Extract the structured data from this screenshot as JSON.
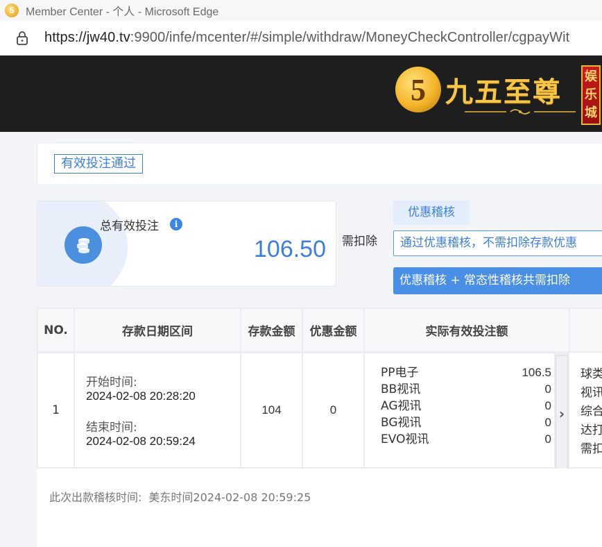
{
  "browser": {
    "window_title": "Member Center - 个人 - Microsoft Edge",
    "url_scheme": "https://",
    "url_host": "jw40.tv",
    "url_rest": ":9900/infe/mcenter/#/simple/withdraw/MoneyCheckController/cgpayWit"
  },
  "header": {
    "brand_mark": "5",
    "brand_name": "九五至尊",
    "brand_tag": [
      "娱",
      "乐",
      "城"
    ]
  },
  "status": {
    "pass_tag": "有效投注通过"
  },
  "summary": {
    "label": "总有效投注",
    "info": "i",
    "value": "106.50",
    "deduct_label": "需扣除",
    "promo_tab": "优惠稽核",
    "promo_message": "通过优惠稽核，不需扣除存款优惠",
    "promo_banner": "优惠稽核 + 常态性稽核共需扣除"
  },
  "table": {
    "headers": {
      "no": "NO.",
      "date_range": "存款日期区间",
      "deposit": "存款金额",
      "bonus": "优惠金额",
      "effective_bet": "实际有效投注额"
    },
    "row": {
      "no": "1",
      "start_label": "开始时间:",
      "start_value": "2024-02-08 20:28:20",
      "end_label": "结束时间:",
      "end_value": "2024-02-08 20:59:24",
      "deposit": "104",
      "bonus": "0",
      "bets": [
        {
          "name": "PP电子",
          "value": "106.5"
        },
        {
          "name": "BB视讯",
          "value": "0"
        },
        {
          "name": "AG视讯",
          "value": "0"
        },
        {
          "name": "BG视讯",
          "value": "0"
        },
        {
          "name": "EVO视讯",
          "value": "0"
        }
      ],
      "scroll_arrow": "›",
      "side_lines": [
        "球类",
        "视讯",
        "综合",
        "达打",
        "需扣"
      ]
    }
  },
  "footer": {
    "label": "此次出款稽核时间:",
    "value": "美东时间2024-02-08 20:59:25"
  },
  "colors": {
    "accent": "#3d7fd8",
    "header_bg": "#1e1e1e",
    "brand_gold": "#f6c648"
  }
}
